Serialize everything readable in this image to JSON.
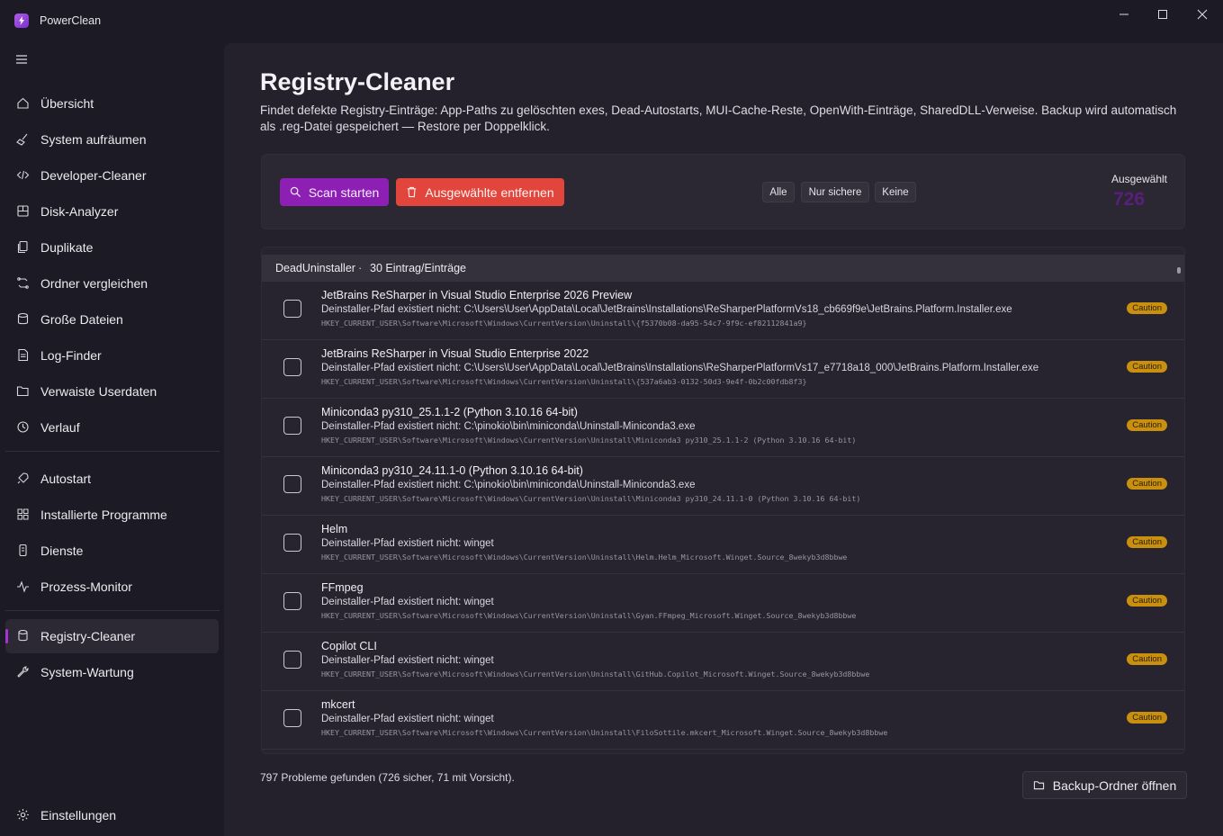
{
  "window": {
    "title": "PowerClean"
  },
  "sidebar": {
    "groups": [
      [
        {
          "label": "Übersicht",
          "icon": "home-icon"
        },
        {
          "label": "System aufräumen",
          "icon": "broom-icon"
        },
        {
          "label": "Developer-Cleaner",
          "icon": "code-icon"
        },
        {
          "label": "Disk-Analyzer",
          "icon": "disk-chart-icon"
        },
        {
          "label": "Duplikate",
          "icon": "copy-icon"
        },
        {
          "label": "Ordner vergleichen",
          "icon": "compare-icon"
        },
        {
          "label": "Große Dateien",
          "icon": "database-icon"
        },
        {
          "label": "Log-Finder",
          "icon": "document-icon"
        },
        {
          "label": "Verwaiste Userdaten",
          "icon": "folder-icon"
        },
        {
          "label": "Verlauf",
          "icon": "history-icon"
        }
      ],
      [
        {
          "label": "Autostart",
          "icon": "rocket-icon"
        },
        {
          "label": "Installierte Programme",
          "icon": "apps-grid-icon"
        },
        {
          "label": "Dienste",
          "icon": "services-icon"
        },
        {
          "label": "Prozess-Monitor",
          "icon": "pulse-icon"
        }
      ],
      [
        {
          "label": "Registry-Cleaner",
          "icon": "registry-icon",
          "active": true
        },
        {
          "label": "System-Wartung",
          "icon": "wrench-icon"
        }
      ]
    ],
    "settings": {
      "label": "Einstellungen",
      "icon": "gear-icon"
    }
  },
  "page": {
    "title": "Registry-Cleaner",
    "description": "Findet defekte Registry-Einträge: App-Paths zu gelöschten exes, Dead-Autostarts, MUI-Cache-Reste, OpenWith-Einträge, SharedDLL-Verweise. Backup wird automatisch als .reg-Datei gespeichert — Restore per Doppelklick."
  },
  "toolbar": {
    "scan_label": "Scan starten",
    "remove_label": "Ausgewählte entfernen",
    "filters": [
      "Alle",
      "Nur sichere",
      "Keine"
    ],
    "selected_label": "Ausgewählt",
    "selected_count": "726",
    "colors": {
      "scan": "#8e1fb5",
      "remove": "#e2453c"
    }
  },
  "group": {
    "name": "DeadUninstaller",
    "separator": "·",
    "count": "30 Eintrag/Einträge"
  },
  "rows": [
    {
      "title": "JetBrains ReSharper in Visual Studio Enterprise 2026 Preview",
      "path": "Deinstaller-Pfad existiert nicht: C:\\Users\\User\\AppData\\Local\\JetBrains\\Installations\\ReSharperPlatformVs18_cb669f9e\\JetBrains.Platform.Installer.exe",
      "key": "HKEY_CURRENT_USER\\Software\\Microsoft\\Windows\\CurrentVersion\\Uninstall\\{f5370b08-da95-54c7-9f9c-ef82112841a9}",
      "badge": "Caution"
    },
    {
      "title": "JetBrains ReSharper in Visual Studio Enterprise 2022",
      "path": "Deinstaller-Pfad existiert nicht: C:\\Users\\User\\AppData\\Local\\JetBrains\\Installations\\ReSharperPlatformVs17_e7718a18_000\\JetBrains.Platform.Installer.exe",
      "key": "HKEY_CURRENT_USER\\Software\\Microsoft\\Windows\\CurrentVersion\\Uninstall\\{537a6ab3-0132-50d3-9e4f-0b2c00fdb8f3}",
      "badge": "Caution"
    },
    {
      "title": "Miniconda3 py310_25.1.1-2 (Python 3.10.16 64-bit)",
      "path": "Deinstaller-Pfad existiert nicht: C:\\pinokio\\bin\\miniconda\\Uninstall-Miniconda3.exe",
      "key": "HKEY_CURRENT_USER\\Software\\Microsoft\\Windows\\CurrentVersion\\Uninstall\\Miniconda3 py310_25.1.1-2 (Python 3.10.16 64-bit)",
      "badge": "Caution"
    },
    {
      "title": "Miniconda3 py310_24.11.1-0 (Python 3.10.16 64-bit)",
      "path": "Deinstaller-Pfad existiert nicht: C:\\pinokio\\bin\\miniconda\\Uninstall-Miniconda3.exe",
      "key": "HKEY_CURRENT_USER\\Software\\Microsoft\\Windows\\CurrentVersion\\Uninstall\\Miniconda3 py310_24.11.1-0 (Python 3.10.16 64-bit)",
      "badge": "Caution"
    },
    {
      "title": "Helm",
      "path": "Deinstaller-Pfad existiert nicht: winget",
      "key": "HKEY_CURRENT_USER\\Software\\Microsoft\\Windows\\CurrentVersion\\Uninstall\\Helm.Helm_Microsoft.Winget.Source_8wekyb3d8bbwe",
      "badge": "Caution"
    },
    {
      "title": "FFmpeg",
      "path": "Deinstaller-Pfad existiert nicht: winget",
      "key": "HKEY_CURRENT_USER\\Software\\Microsoft\\Windows\\CurrentVersion\\Uninstall\\Gyan.FFmpeg_Microsoft.Winget.Source_8wekyb3d8bbwe",
      "badge": "Caution"
    },
    {
      "title": "Copilot CLI",
      "path": "Deinstaller-Pfad existiert nicht: winget",
      "key": "HKEY_CURRENT_USER\\Software\\Microsoft\\Windows\\CurrentVersion\\Uninstall\\GitHub.Copilot_Microsoft.Winget.Source_8wekyb3d8bbwe",
      "badge": "Caution"
    },
    {
      "title": "mkcert",
      "path": "Deinstaller-Pfad existiert nicht: winget",
      "key": "HKEY_CURRENT_USER\\Software\\Microsoft\\Windows\\CurrentVersion\\Uninstall\\FiloSottile.mkcert_Microsoft.Winget.Source_8wekyb3d8bbwe",
      "badge": "Caution"
    }
  ],
  "footer": {
    "status": "797 Probleme gefunden (726 sicher, 71 mit Vorsicht).",
    "backup_label": "Backup-Ordner öffnen"
  }
}
